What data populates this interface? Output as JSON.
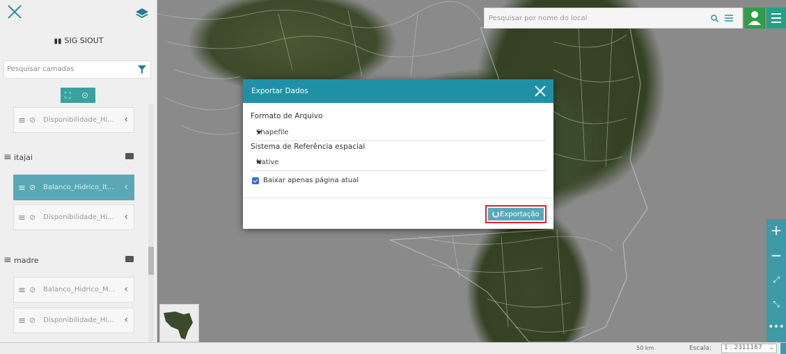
{
  "sidebar": {
    "brand": "SIG SIOUT",
    "search_placeholder": "Pesquisar camadas",
    "items": [
      {
        "type": "layer",
        "label": "Disponibilidade_Hi...",
        "active": false
      },
      {
        "type": "group",
        "label": "itajai"
      },
      {
        "type": "layer",
        "label": "Balanco_Hidrico_It...",
        "active": true
      },
      {
        "type": "layer",
        "label": "Disponibilidade_Hi...",
        "active": false
      },
      {
        "type": "group",
        "label": "madre"
      },
      {
        "type": "layer",
        "label": "Balanco_Hidrico_M...",
        "active": false
      },
      {
        "type": "layer",
        "label": "Disponibilidade_Hi...",
        "active": false
      }
    ]
  },
  "top_search": {
    "placeholder": "Pesquisar por nome do local"
  },
  "bottom_bar": {
    "scale_bar_label": "50 km",
    "escala_label": "Escala:",
    "escala_value": "1 : 2311167"
  },
  "modal": {
    "title": "Exportar Dados",
    "format_label": "Formato de Arquivo",
    "format_value": "Shapefile",
    "srs_label": "Sistema de Referência espacial",
    "srs_value": "Native",
    "checkbox_label": "Baixar apenas página atual",
    "checkbox_checked": true,
    "export_label": "Exportação"
  },
  "colors": {
    "modal_header": "#1e91a7",
    "export_button": "#58a9b8",
    "highlight_border": "#e0202a",
    "active_layer": "#5aa8b5",
    "user_button": "#2f9d4a"
  },
  "icons": [
    "close-icon",
    "layers-icon",
    "filter-icon",
    "search-icon",
    "menu-icon",
    "user-icon",
    "eye-off-icon",
    "folder-icon",
    "spinner-icon"
  ]
}
